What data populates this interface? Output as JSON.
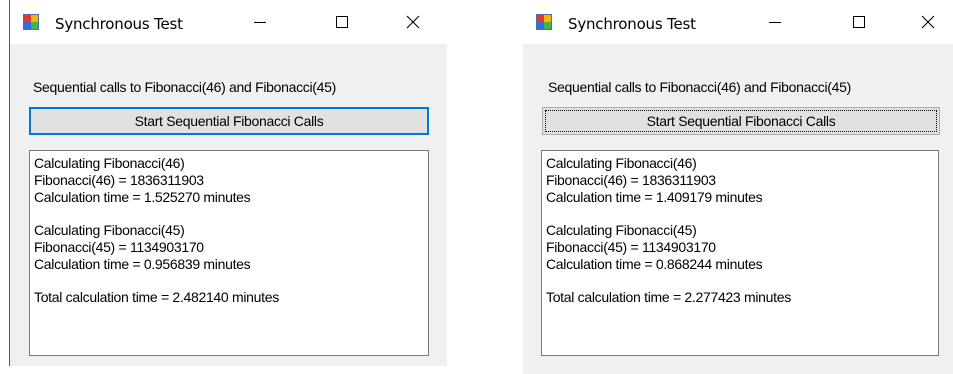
{
  "windows": [
    {
      "title": "Synchronous Test",
      "description_label": "Sequential calls to Fibonacci(46) and Fibonacci(45)",
      "button_label": "Start Sequential Fibonacci Calls",
      "output": {
        "line1": "Calculating Fibonacci(46)",
        "line2": "Fibonacci(46) = 1836311903",
        "line3": "Calculation time = 1.525270 minutes",
        "line4": "Calculating Fibonacci(45)",
        "line5": "Fibonacci(45) = 1134903170",
        "line6": "Calculation time = 0.956839 minutes",
        "line7": "Total calculation time = 2.482140 minutes"
      }
    },
    {
      "title": "Synchronous Test",
      "description_label": "Sequential calls to Fibonacci(46) and Fibonacci(45)",
      "button_label": "Start Sequential Fibonacci Calls",
      "output": {
        "line1": "Calculating Fibonacci(46)",
        "line2": "Fibonacci(46) = 1836311903",
        "line3": "Calculation time = 1.409179 minutes",
        "line4": "Calculating Fibonacci(45)",
        "line5": "Fibonacci(45) = 1134903170",
        "line6": "Calculation time = 0.868244 minutes",
        "line7": "Total calculation time = 2.277423 minutes"
      }
    }
  ],
  "icons": {
    "app": "winforms-app-icon",
    "minimize": "minimize-icon",
    "maximize": "maximize-icon",
    "close": "close-icon"
  },
  "colors": {
    "focus_border": "#0078d7",
    "window_bg": "#f0f0f0",
    "button_bg": "#e1e1e1"
  }
}
